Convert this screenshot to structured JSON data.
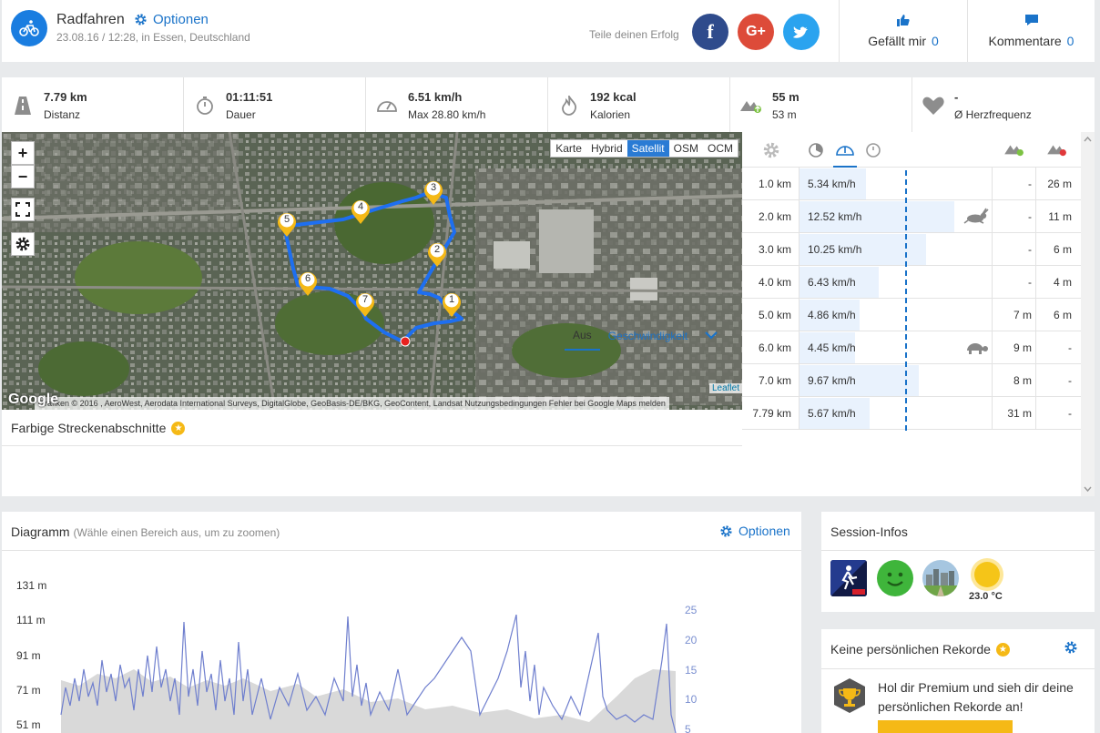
{
  "header": {
    "title": "Radfahren",
    "options_label": "Optionen",
    "meta": "23.08.16 / 12:28, in Essen, Deutschland",
    "share_label": "Teile deinen Erfolg",
    "likes_label": "Gefällt mir",
    "likes_count": "0",
    "comments_label": "Kommentare",
    "comments_count": "0"
  },
  "stats": [
    {
      "icon": "road-icon",
      "value": "7.79 km",
      "label": "Distanz"
    },
    {
      "icon": "stopwatch-icon",
      "value": "01:11:51",
      "label": "Dauer"
    },
    {
      "icon": "speedometer-icon",
      "value": "6.51 km/h",
      "label": "Max 28.80 km/h"
    },
    {
      "icon": "flame-icon",
      "value": "192 kcal",
      "label": "Kalorien"
    },
    {
      "icon": "elevation-up-icon",
      "value": "55 m",
      "label": "53 m"
    },
    {
      "icon": "heart-icon",
      "value": "-",
      "label": "Ø Herzfrequenz"
    }
  ],
  "map": {
    "layers": [
      "Karte",
      "Hybrid",
      "Satellit",
      "OSM",
      "OCM"
    ],
    "active_layer": "Satellit",
    "attribution": "Grafiken © 2016 , AeroWest, Aerodata International Surveys, DigitalGlobe, GeoBasis-DE/BKG, GeoContent, Landsat    Nutzungsbedingungen    Fehler bei Google Maps melden",
    "leaflet": "Leaflet",
    "google": "Google",
    "markers": [
      "1",
      "2",
      "3",
      "4",
      "5",
      "6",
      "7"
    ]
  },
  "segments": {
    "title": "Farbige Streckenabschnitte",
    "tabs": [
      "Aus",
      "Geschwindigkeit"
    ],
    "active_tab": "Aus"
  },
  "splits": [
    {
      "km": "1.0 km",
      "speed": "5.34 km/h",
      "bar": 0.43,
      "up": "-",
      "down": "26 m",
      "badge": ""
    },
    {
      "km": "2.0 km",
      "speed": "12.52 km/h",
      "bar": 1.0,
      "up": "-",
      "down": "11 m",
      "badge": "rabbit-icon"
    },
    {
      "km": "3.0 km",
      "speed": "10.25 km/h",
      "bar": 0.82,
      "up": "-",
      "down": "6 m",
      "badge": ""
    },
    {
      "km": "4.0 km",
      "speed": "6.43 km/h",
      "bar": 0.51,
      "up": "-",
      "down": "4 m",
      "badge": ""
    },
    {
      "km": "5.0 km",
      "speed": "4.86 km/h",
      "bar": 0.39,
      "up": "7 m",
      "down": "6 m",
      "badge": ""
    },
    {
      "km": "6.0 km",
      "speed": "4.45 km/h",
      "bar": 0.36,
      "up": "9 m",
      "down": "-",
      "badge": "turtle-icon"
    },
    {
      "km": "7.0 km",
      "speed": "9.67 km/h",
      "bar": 0.77,
      "up": "8 m",
      "down": "-",
      "badge": ""
    },
    {
      "km": "7.79 km",
      "speed": "5.67 km/h",
      "bar": 0.45,
      "up": "31 m",
      "down": "-",
      "badge": ""
    }
  ],
  "diagram": {
    "title": "Diagramm",
    "hint": "(Wähle einen Bereich aus, um zu zoomen)",
    "options_label": "Optionen",
    "y_left": [
      "131 m",
      "111 m",
      "91 m",
      "71 m",
      "51 m"
    ],
    "y_right": [
      "25",
      "20",
      "15",
      "10",
      "5"
    ]
  },
  "session": {
    "title": "Session-Infos",
    "temperature": "23.0 °C"
  },
  "records": {
    "title": "Keine persönlichen Rekorde",
    "text": "Hol dir Premium und sieh dir deine persönlichen Rekorde an!"
  },
  "colors": {
    "accent": "#1a73c9",
    "route": "#1e6ff0",
    "marker": "#f5b916",
    "bar": "#e9f2fd"
  }
}
